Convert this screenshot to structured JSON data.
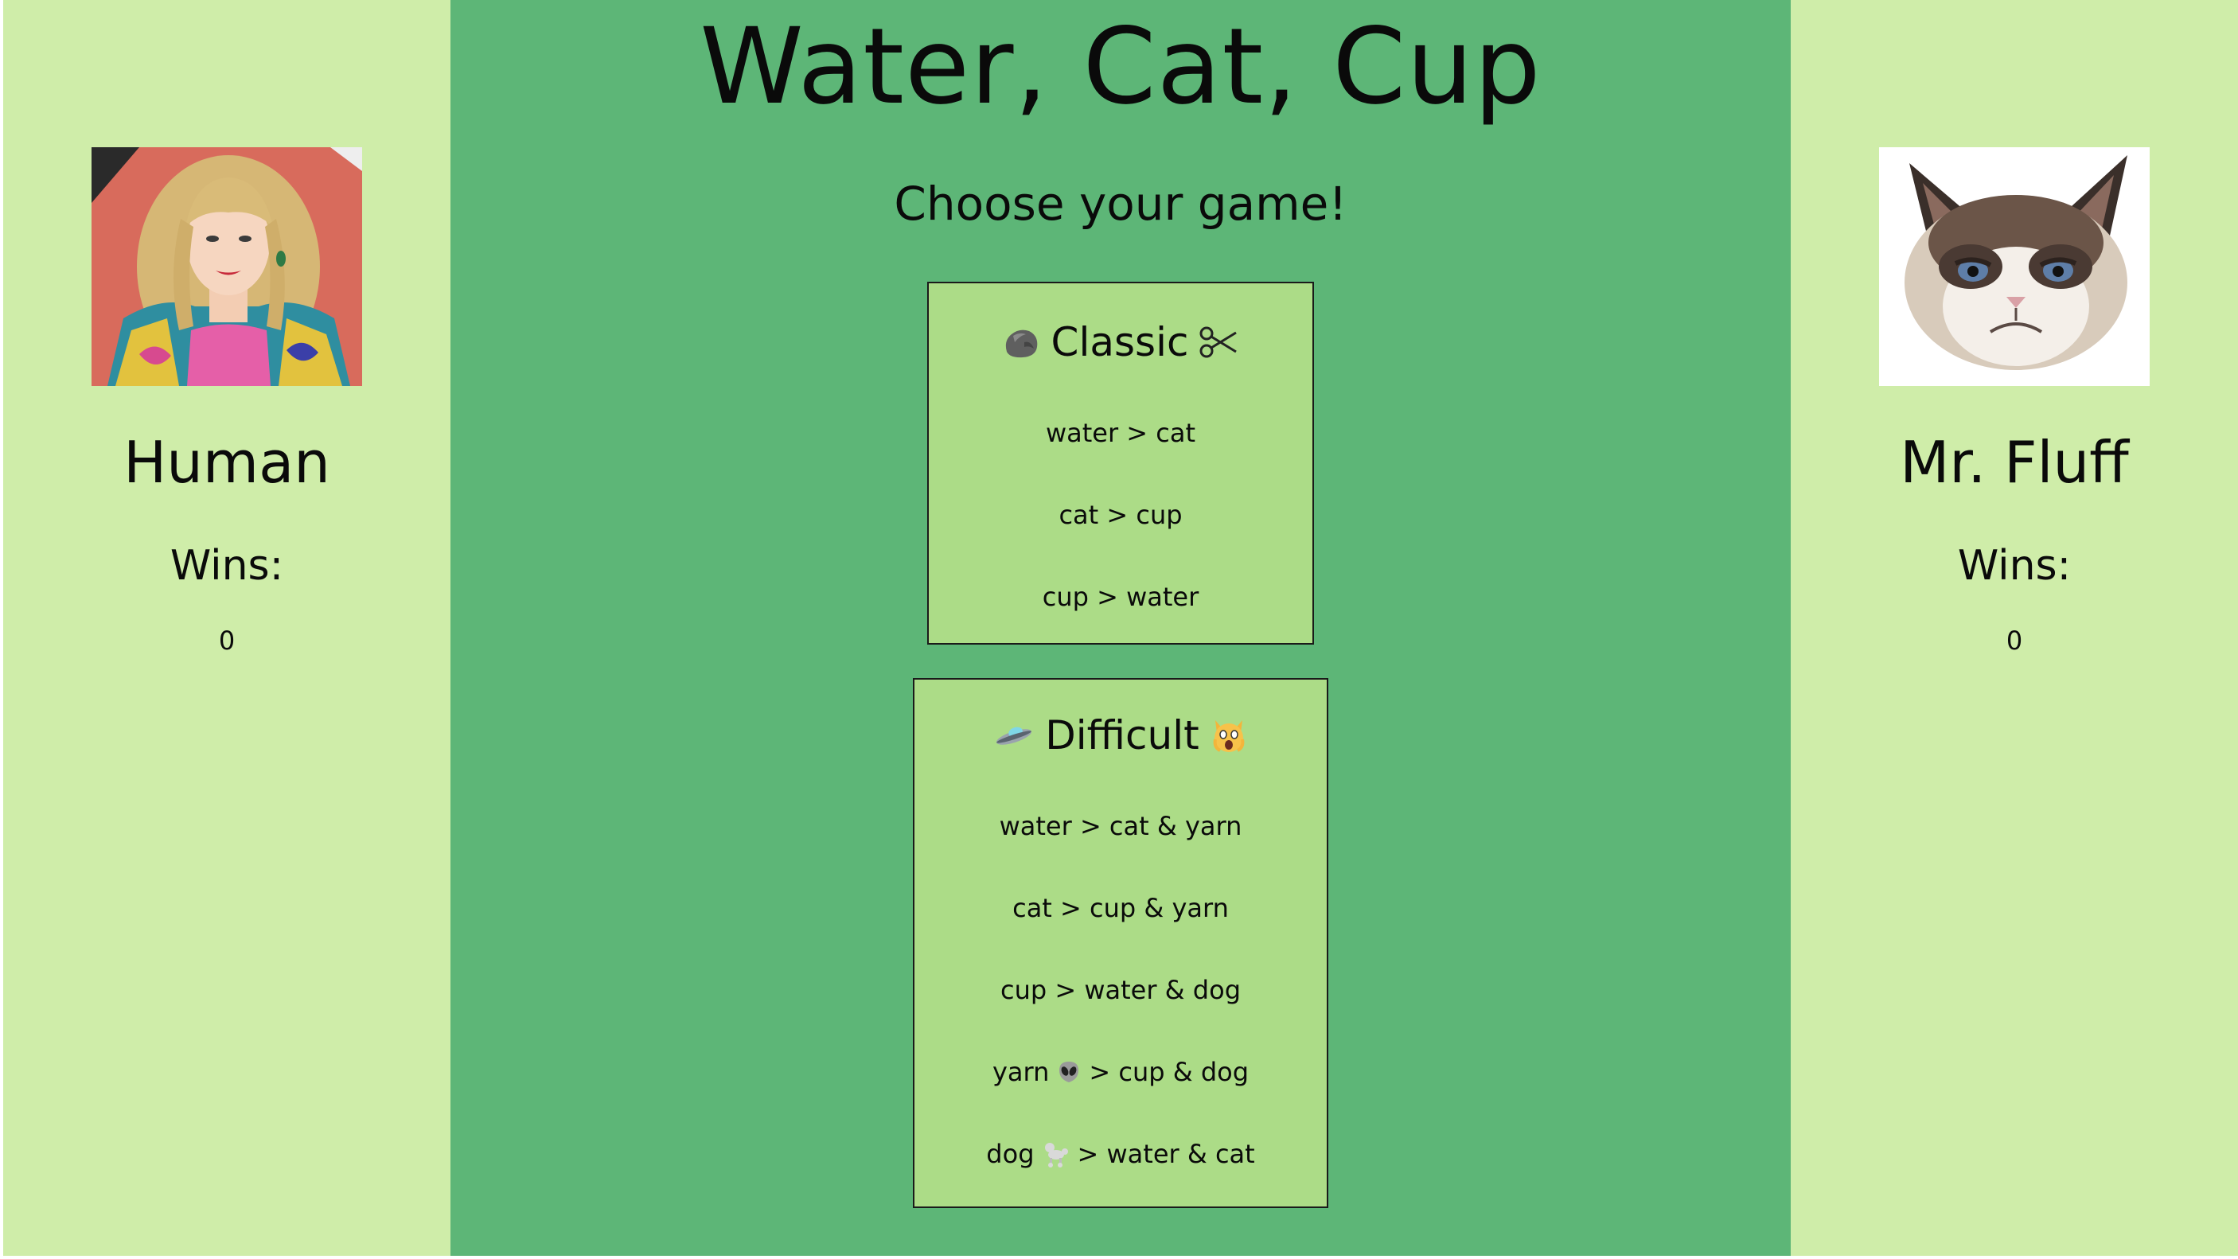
{
  "app": {
    "title": "Water, Cat, Cup",
    "subtitle": "Choose your game!"
  },
  "players": {
    "human": {
      "name": "Human",
      "wins_label": "Wins:",
      "wins": "0",
      "avatar_icon": "human-portrait-icon"
    },
    "computer": {
      "name": "Mr. Fluff",
      "wins_label": "Wins:",
      "wins": "0",
      "avatar_icon": "grumpy-cat-icon"
    }
  },
  "games": {
    "classic": {
      "title": "Classic",
      "left_icon": "rock-icon",
      "right_icon": "scissors-icon",
      "rules": [
        "water > cat",
        "cat > cup",
        "cup > water"
      ]
    },
    "difficult": {
      "title": "Difficult",
      "left_icon": "ufo-icon",
      "right_icon": "screaming-cat-icon",
      "rules": [
        {
          "before": "water > cat & yarn",
          "icon": "",
          "after": ""
        },
        {
          "before": "cat > cup & yarn",
          "icon": "",
          "after": ""
        },
        {
          "before": "cup > water & dog",
          "icon": "",
          "after": ""
        },
        {
          "before": "yarn",
          "icon": "alien-icon",
          "after": "> cup & dog"
        },
        {
          "before": "dog",
          "icon": "poodle-icon",
          "after": "> water & cat"
        }
      ]
    }
  },
  "colors": {
    "side_panel": "#cfeda9",
    "center_panel": "#5db677",
    "card": "#acdc87",
    "text": "#0a0a0a"
  }
}
